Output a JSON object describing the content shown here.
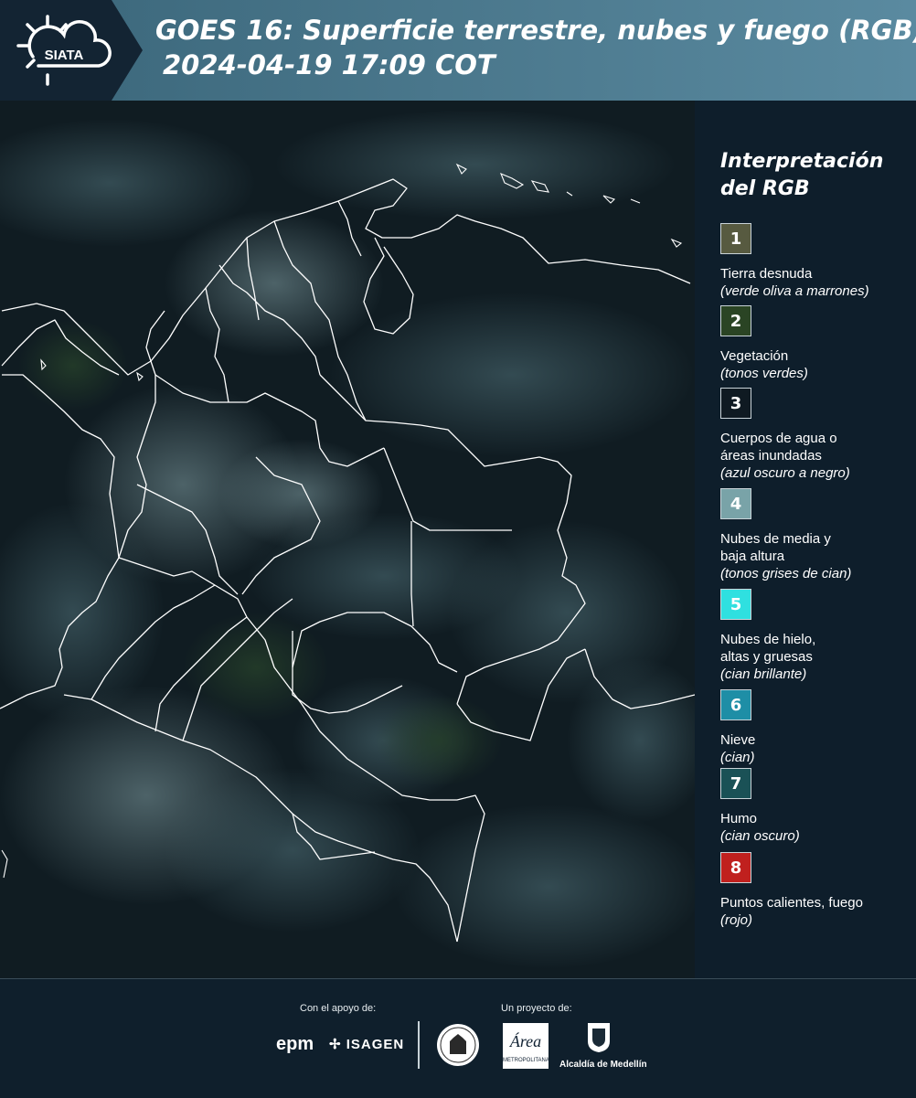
{
  "header": {
    "logo_text": "SIATA",
    "title_line1": "GOES 16: Superficie terrestre, nubes y fuego (RGB)",
    "title_line2": "2024-04-19 17:09 COT"
  },
  "legend": {
    "title_line1": "Interpretación",
    "title_line2": "del RGB",
    "items": [
      {
        "number": "1",
        "label": [
          "Tierra desnuda"
        ],
        "sub": "(verde oliva a marrones)",
        "color": "#575a40"
      },
      {
        "number": "2",
        "label": [
          "Vegetación"
        ],
        "sub": "(tonos verdes)",
        "color": "#2a4424"
      },
      {
        "number": "3",
        "label": [
          "Cuerpos de agua o",
          "áreas inundadas"
        ],
        "sub": "(azul oscuro a negro)",
        "color": "#0f1a22"
      },
      {
        "number": "4",
        "label": [
          "Nubes de media y",
          "baja altura"
        ],
        "sub": "(tonos grises de cian)",
        "color": "#79a3a8"
      },
      {
        "number": "5",
        "label": [
          "Nubes de hielo,",
          "altas y gruesas"
        ],
        "sub": "(cian brillante)",
        "color": "#2fe0e0"
      },
      {
        "number": "6",
        "label": [
          "Nieve"
        ],
        "sub": "(cian)",
        "color": "#1e8ea6"
      },
      {
        "number": "7",
        "label": [
          "Humo"
        ],
        "sub": "(cian oscuro)",
        "color": "#1a5156"
      },
      {
        "number": "8",
        "label": [
          "Puntos calientes, fuego"
        ],
        "sub": "(rojo)",
        "color": "#c0201e"
      }
    ]
  },
  "footer": {
    "support_label": "Con el apoyo de:",
    "project_label": "Un proyecto de:",
    "sponsor_epm": "epm",
    "sponsor_isagen": "ISAGEN",
    "area_metropolitana": "METROPOLITANA",
    "area_name": "Área",
    "alcaldia": "Alcaldía de Medellín"
  }
}
